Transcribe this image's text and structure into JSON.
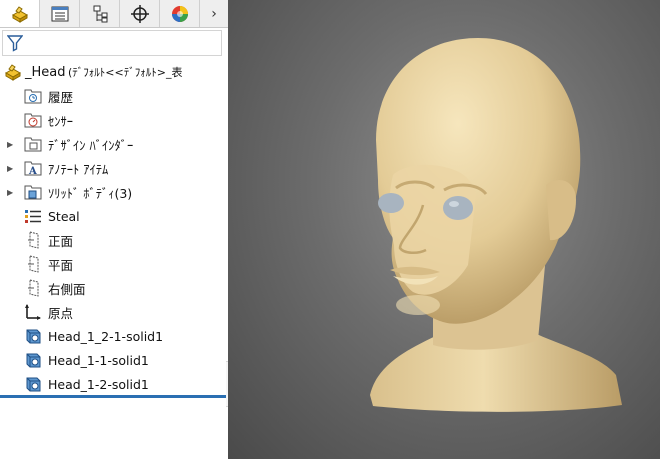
{
  "tabs": [
    {
      "name": "feature-manager-tab",
      "icon": "part-icon",
      "active": true
    },
    {
      "name": "property-manager-tab",
      "icon": "property-list-icon",
      "active": false
    },
    {
      "name": "configuration-manager-tab",
      "icon": "configuration-icon",
      "active": false
    },
    {
      "name": "dimxpert-tab",
      "icon": "crosshair-icon",
      "active": false
    },
    {
      "name": "display-manager-tab",
      "icon": "appearance-ball-icon",
      "active": false
    }
  ],
  "more_tabs_glyph": "›",
  "root": {
    "label": "_Head",
    "config": "(ﾃﾞﾌｫﾙﾄ<<ﾃﾞﾌｫﾙﾄ>_表"
  },
  "tree": [
    {
      "label": "履歴",
      "icon": "history-icon",
      "expandable": false
    },
    {
      "label": "ｾﾝｻｰ",
      "icon": "sensor-icon",
      "expandable": false
    },
    {
      "label": "ﾃﾞｻﾞｲﾝ ﾊﾞｲﾝﾀﾞｰ",
      "icon": "design-binder-icon",
      "expandable": true
    },
    {
      "label": "ｱﾉﾃｰﾄ ｱｲﾃﾑ",
      "icon": "annotations-icon",
      "expandable": true
    },
    {
      "label": "ｿﾘｯﾄﾞ ﾎﾞﾃﾞｨ(3)",
      "icon": "solid-bodies-icon",
      "expandable": true
    },
    {
      "label": "Steal",
      "icon": "material-icon",
      "expandable": false
    },
    {
      "label": "正面",
      "icon": "plane-icon",
      "expandable": false
    },
    {
      "label": "平面",
      "icon": "plane-icon",
      "expandable": false
    },
    {
      "label": "右側面",
      "icon": "plane-icon",
      "expandable": false
    },
    {
      "label": "原点",
      "icon": "origin-icon",
      "expandable": false
    },
    {
      "label": "Head_1_2-1-solid1",
      "icon": "imported-body-icon",
      "expandable": false
    },
    {
      "label": "Head_1-1-solid1",
      "icon": "imported-body-icon",
      "expandable": false
    },
    {
      "label": "Head_1-2-solid1",
      "icon": "imported-body-icon",
      "expandable": false
    }
  ],
  "colors": {
    "accent": "#2a6fb2",
    "model_skin": "#e7d3a4",
    "eye": "#a8b4c0",
    "background_center": "#8e8e8e",
    "background_edge": "#4a4a4a"
  }
}
